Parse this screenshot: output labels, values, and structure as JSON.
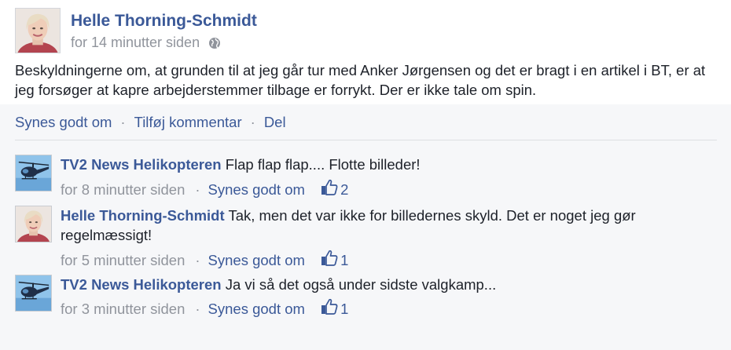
{
  "post": {
    "author": "Helle Thorning-Schmidt",
    "time": "for 14 minutter siden",
    "privacy_icon": "globe-icon",
    "text": "Beskyldningerne om, at grunden til at jeg går tur med Anker Jørgensen og det er bragt i en artikel i BT, er at jeg forsøger at kapre arbejderstemmer tilbage er forrykt. Der er ikke tale om spin."
  },
  "actions": {
    "like": "Synes godt om",
    "comment": "Tilføj kommentar",
    "share": "Del",
    "separator": "·"
  },
  "comments": [
    {
      "author": "TV2 News Helikopteren",
      "text": "Flap flap flap....  Flotte billeder!",
      "time": "for 8 minutter siden",
      "like_label": "Synes godt om",
      "likes": "2",
      "separator": "·"
    },
    {
      "author": "Helle Thorning-Schmidt",
      "text": "Tak, men det var ikke for billedernes skyld. Det er noget jeg gør regelmæssigt!",
      "time": "for 5 minutter siden",
      "like_label": "Synes godt om",
      "likes": "1",
      "separator": "·"
    },
    {
      "author": "TV2 News Helikopteren",
      "text": "Ja vi så det også under sidste valgkamp...",
      "time": "for 3 minutter siden",
      "like_label": "Synes godt om",
      "likes": "1",
      "separator": "·"
    }
  ],
  "colors": {
    "link": "#3b5998",
    "meta": "#90949c",
    "text": "#1d2129",
    "comment_bg": "#f6f7f9"
  }
}
